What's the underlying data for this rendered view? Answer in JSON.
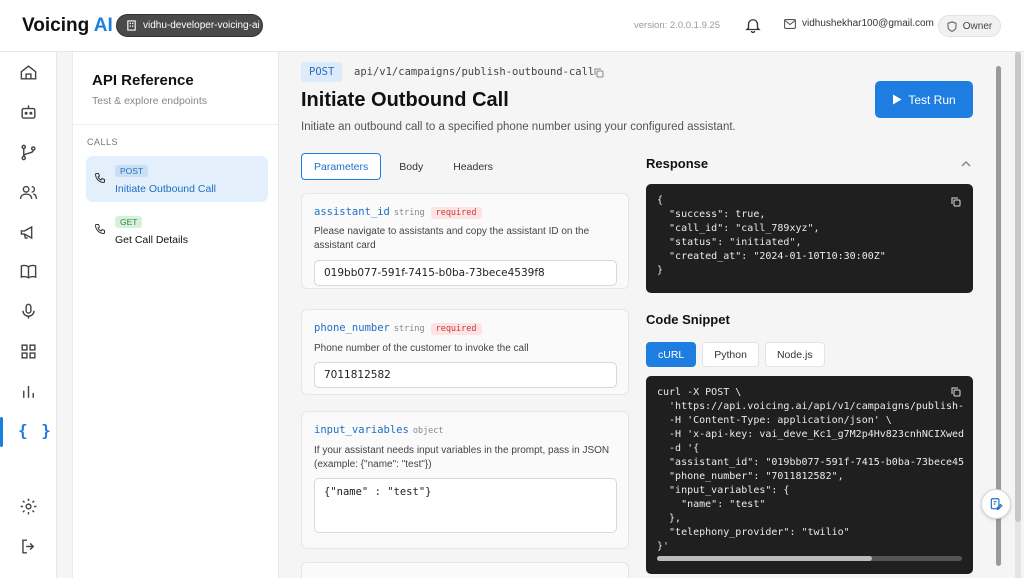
{
  "header": {
    "brand_main": "Voicing ",
    "brand_accent": "AI",
    "workspace": "vidhu-developer-voicing-ai",
    "version": "version: 2.0.0.1.9.25",
    "email": "vidhushekhar100@gmail.com",
    "role": "Owner"
  },
  "rail": {
    "active_icon": "{ }",
    "icons": [
      "home-icon",
      "bot-icon",
      "git-branch-icon",
      "users-icon",
      "megaphone-icon",
      "book-icon",
      "mic-icon",
      "grid-icon",
      "bar-chart-icon",
      "code-braces-icon",
      "settings-icon",
      "logout-icon"
    ]
  },
  "reference": {
    "title": "API Reference",
    "subtitle": "Test & explore endpoints",
    "section": "CALLS",
    "endpoints": [
      {
        "method": "POST",
        "name": "Initiate Outbound Call"
      },
      {
        "method": "GET",
        "name": "Get Call Details"
      }
    ]
  },
  "main": {
    "method": "POST",
    "path": "api/v1/campaigns/publish-outbound-call",
    "title": "Initiate Outbound Call",
    "description": "Initiate an outbound call to a specified phone number using your configured assistant.",
    "test_run": "Test Run",
    "tabs": [
      "Parameters",
      "Body",
      "Headers"
    ],
    "params": [
      {
        "name": "assistant_id",
        "type": "string",
        "required": "required",
        "description": "Please navigate to assistants and copy the assistant ID on the assistant card",
        "value": "019bb077-591f-7415-b0ba-73bece4539f8"
      },
      {
        "name": "phone_number",
        "type": "string",
        "required": "required",
        "description": "Phone number of the customer to invoke the call",
        "value": "7011812582"
      },
      {
        "name": "input_variables",
        "type": "object",
        "description": "If your assistant needs input variables in the prompt, pass in JSON (example: {\"name\": \"test\"})",
        "value": "{\"name\" : \"test\"}"
      }
    ]
  },
  "response": {
    "title": "Response",
    "body": "{\n  \"success\": true,\n  \"call_id\": \"call_789xyz\",\n  \"status\": \"initiated\",\n  \"created_at\": \"2024-01-10T10:30:00Z\"\n}"
  },
  "snippet": {
    "title": "Code Snippet",
    "languages": [
      "cURL",
      "Python",
      "Node.js"
    ],
    "code": "curl -X POST \\\n  'https://api.voicing.ai/api/v1/campaigns/publish-\n  -H 'Content-Type: application/json' \\\n  -H 'x-api-key: vai_deve_Kc1_g7M2p4Hv823cnhNCIXwed\n  -d '{\n  \"assistant_id\": \"019bb077-591f-7415-b0ba-73bece45\n  \"phone_number\": \"7011812582\",\n  \"input_variables\": {\n    \"name\": \"test\"\n  },\n  \"telephony_provider\": \"twilio\"\n}'"
  },
  "colors": {
    "accent": "#1e7de0",
    "code_bg": "#1f1f1f",
    "required": "#c93a3a"
  }
}
